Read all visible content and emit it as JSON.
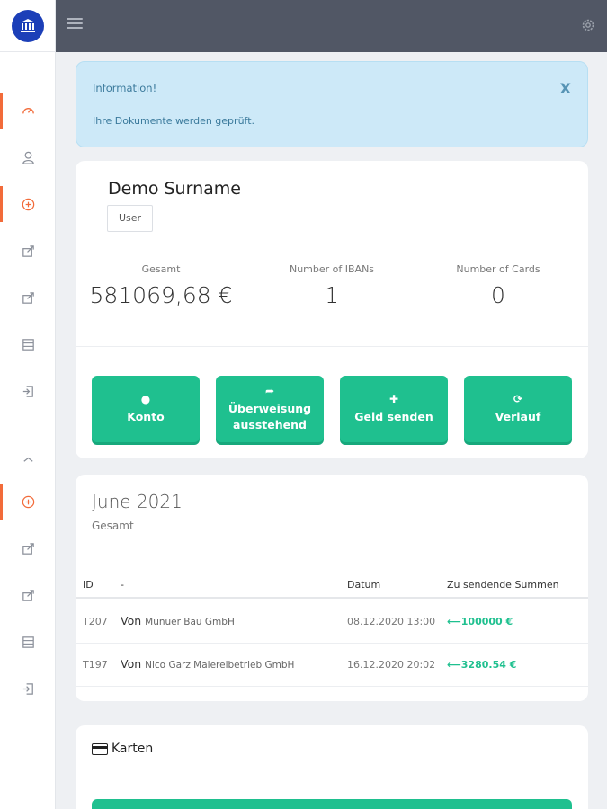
{
  "alert": {
    "title": "Information!",
    "message": "Ihre Dokumente werden geprüft.",
    "close": "X"
  },
  "profile": {
    "name": "Demo Surname",
    "role": "User",
    "stats": [
      {
        "label": "Gesamt",
        "value": "581069,68 €"
      },
      {
        "label": "Number of IBANs",
        "value": "1"
      },
      {
        "label": "Number of Cards",
        "value": "0"
      }
    ]
  },
  "actions": [
    {
      "label": "Konto",
      "icon": "user-icon"
    },
    {
      "label": "Überweisung ausstehend",
      "icon": "share-icon"
    },
    {
      "label": "Geld senden",
      "icon": "plus-icon"
    },
    {
      "label": "Verlauf",
      "icon": "history-icon"
    }
  ],
  "transactions": {
    "month": "June 2021",
    "subtitle": "Gesamt",
    "columns": [
      "ID",
      "-",
      "Datum",
      "Zu sendende Summen"
    ],
    "rows": [
      {
        "id": "T207",
        "von": "Von",
        "name": "Munuer Bau GmbH",
        "date": "08.12.2020 13:00",
        "amount": "⟵100000 €"
      },
      {
        "id": "T197",
        "von": "Von",
        "name": "Nico Garz Malereibetrieb GmbH",
        "date": "16.12.2020 20:02",
        "amount": "⟵3280.54 €"
      }
    ]
  },
  "cards_section": {
    "title": "Karten"
  },
  "colors": {
    "accent": "#1fc08f",
    "sidebar_active": "#f26b3a",
    "topbar": "#515765",
    "logo": "#1c3fb8"
  }
}
